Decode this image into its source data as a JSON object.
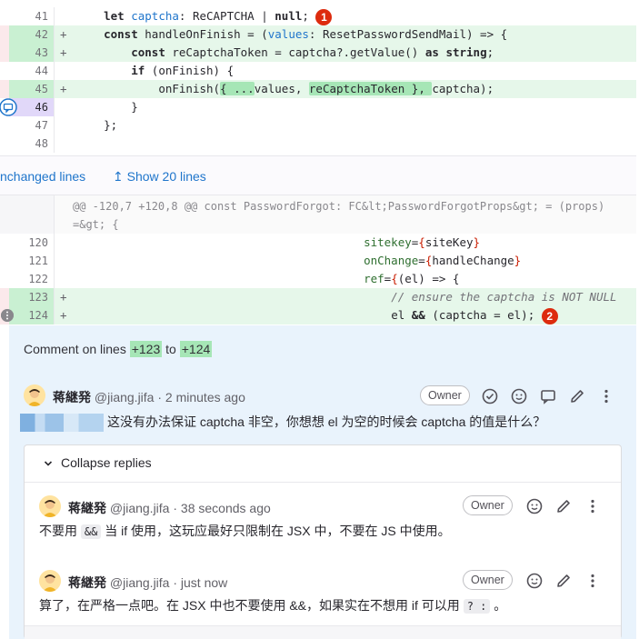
{
  "diff": {
    "lines_top": [
      {
        "num": "41",
        "type": "ctx",
        "code": "    let captcha: ReCAPTCHA | null;",
        "marker": "1"
      },
      {
        "num": "42",
        "type": "add",
        "code": "    const handleOnFinish = (values: ResetPasswordSendMail) => {"
      },
      {
        "num": "43",
        "type": "add",
        "code": "        const reCaptchaToken = captcha?.getValue() as string;"
      },
      {
        "num": "44",
        "type": "ctx",
        "code": "        if (onFinish) {"
      },
      {
        "num": "45",
        "type": "add",
        "code": "            onFinish({ ...values, reCaptchaToken }, captcha);"
      },
      {
        "num": "46",
        "type": "ctx",
        "code": "        }"
      },
      {
        "num": "47",
        "type": "ctx",
        "code": "    };"
      },
      {
        "num": "48",
        "type": "ctx",
        "code": ""
      }
    ],
    "plus_sign": "+",
    "unchanged_label": "nchanged lines",
    "show_label": "Show 20 lines",
    "show_arrow": "↥",
    "hunk_header": "@@ -120,7 +120,8 @@ const PasswordForgot: FC&lt;PasswordForgotProps&gt; = (props) =&gt; {",
    "lines_bottom": [
      {
        "num": "120",
        "type": "ctx",
        "code": "                                          sitekey={siteKey}"
      },
      {
        "num": "121",
        "type": "ctx",
        "code": "                                          onChange={handleChange}"
      },
      {
        "num": "122",
        "type": "ctx",
        "code": "                                          ref={(el) => {"
      },
      {
        "num": "123",
        "type": "add",
        "code": "                                              // ensure the captcha is NOT NULL"
      },
      {
        "num": "124",
        "type": "add",
        "code": "                                              el && (captcha = el);",
        "marker": "2"
      }
    ]
  },
  "discussion": {
    "comment_on_prefix": "Comment on lines",
    "line_from": "+123",
    "line_to_word": "to",
    "line_to": "+124",
    "main_note": {
      "author": "蒋継発",
      "meta": "@jiang.jifa · 2 minutes ago",
      "role": "Owner",
      "body": "这没有办法保证 captcha 非空，你想想 el 为空的时候会 captcha 的值是什么？"
    },
    "collapse_label": "Collapse replies",
    "replies": [
      {
        "author": "蒋継発",
        "meta": "@jiang.jifa · 38 seconds ago",
        "role": "Owner",
        "body_pre": "不要用",
        "body_code": "&&",
        "body_post": "当 if 使用，这玩应最好只限制在 JSX 中，不要在 JS 中使用。"
      },
      {
        "author": "蒋継発",
        "meta": "@jiang.jifa · just now",
        "role": "Owner",
        "body_pre": "算了，在严格一点吧。在 JSX 中也不要使用 &&，如果实在不想用 if 可以用",
        "body_code": "? :",
        "body_post": "。"
      }
    ]
  },
  "colors": {
    "added_bg": "#e6f7ea",
    "discussion_bg": "#e9f3fc",
    "link": "#1f75cb",
    "marker_red": "#dd2b0e"
  }
}
